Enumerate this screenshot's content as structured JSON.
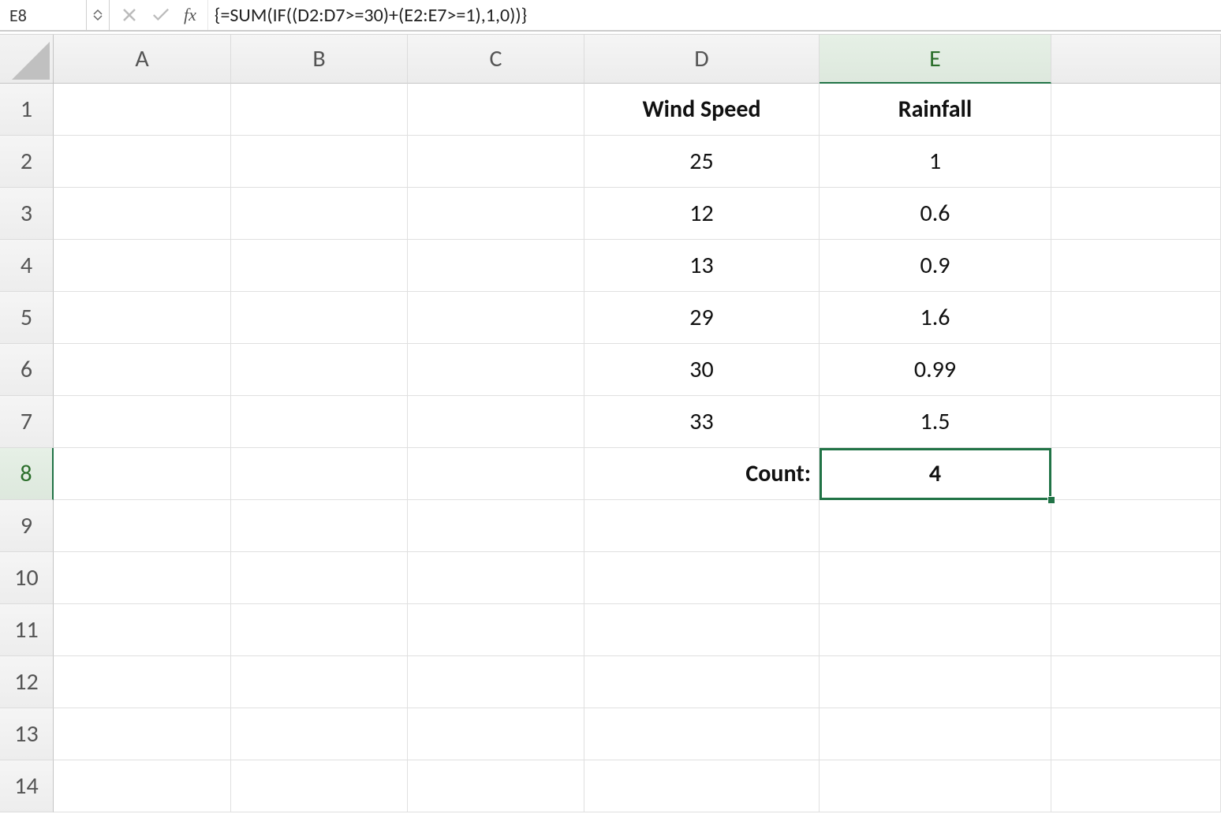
{
  "formulaBar": {
    "nameBox": "E8",
    "fxLabel": "fx",
    "formula": "{=SUM(IF((D2:D7>=30)+(E2:E7>=1),1,0))}"
  },
  "columns": [
    "A",
    "B",
    "C",
    "D",
    "E"
  ],
  "rows": [
    "1",
    "2",
    "3",
    "4",
    "5",
    "6",
    "7",
    "8",
    "9",
    "10",
    "11",
    "12",
    "13",
    "14"
  ],
  "activeCell": {
    "col": "E",
    "row": "8"
  },
  "grid": {
    "D1": "Wind Speed",
    "E1": "Rainfall",
    "D2": "25",
    "E2": "1",
    "D3": "12",
    "E3": "0.6",
    "D4": "13",
    "E4": "0.9",
    "D5": "29",
    "E5": "1.6",
    "D6": "30",
    "E6": "0.99",
    "D7": "33",
    "E7": "1.5",
    "D8": "Count:",
    "E8": "4"
  },
  "chart_data": {
    "type": "table",
    "columns": [
      "Wind Speed",
      "Rainfall"
    ],
    "rows": [
      [
        25,
        1
      ],
      [
        12,
        0.6
      ],
      [
        13,
        0.9
      ],
      [
        29,
        1.6
      ],
      [
        30,
        0.99
      ],
      [
        33,
        1.5
      ]
    ],
    "summary": {
      "label": "Count:",
      "value": 4
    }
  }
}
